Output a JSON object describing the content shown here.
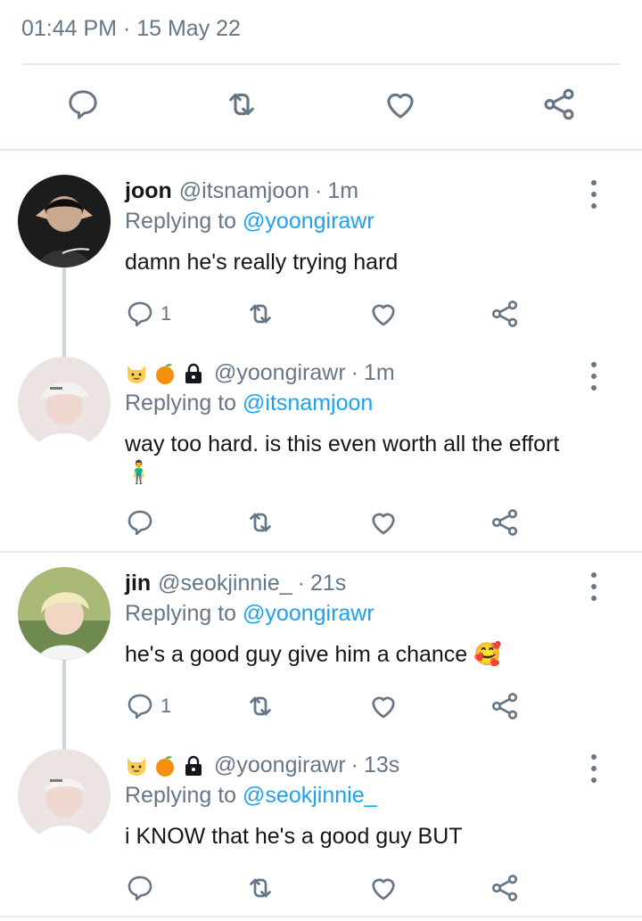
{
  "header": {
    "timestamp": "01:44 PM · 15 May 22"
  },
  "tweets": [
    {
      "name": "joon",
      "handle": "@itsnamjoon",
      "time": "1m",
      "replying_prefix": "Replying to ",
      "replying_to": "@yoongirawr",
      "text": "damn he's really trying hard",
      "reply_count": "1",
      "avatar_color": "#2b2b2b"
    },
    {
      "name": "",
      "handle": "@yoongirawr",
      "time": "1m",
      "replying_prefix": "Replying to ",
      "replying_to": "@itsnamjoon",
      "text": "way too hard. is this even worth all the effort 🧍‍♂️",
      "reply_count": "",
      "avatar_color": "#e6dcdd"
    },
    {
      "name": "jin",
      "handle": "@seokjinnie_",
      "time": "21s",
      "replying_prefix": "Replying to ",
      "replying_to": "@yoongirawr",
      "text": "he's a good guy give him a chance 🥰",
      "reply_count": "1",
      "avatar_color": "#b9c98a"
    },
    {
      "name": "",
      "handle": "@yoongirawr",
      "time": "13s",
      "replying_prefix": "Replying to ",
      "replying_to": "@seokjinnie_",
      "text": "i KNOW that he's a good guy BUT",
      "reply_count": "",
      "avatar_color": "#e6dcdd"
    }
  ],
  "colors": {
    "accent": "#1da1f2",
    "muted": "#657786",
    "divider": "#e6ecf0"
  },
  "icons": [
    "reply-icon",
    "retweet-icon",
    "like-icon",
    "share-icon",
    "more-icon",
    "cat-emoji",
    "tangerine-emoji",
    "lock-icon"
  ]
}
